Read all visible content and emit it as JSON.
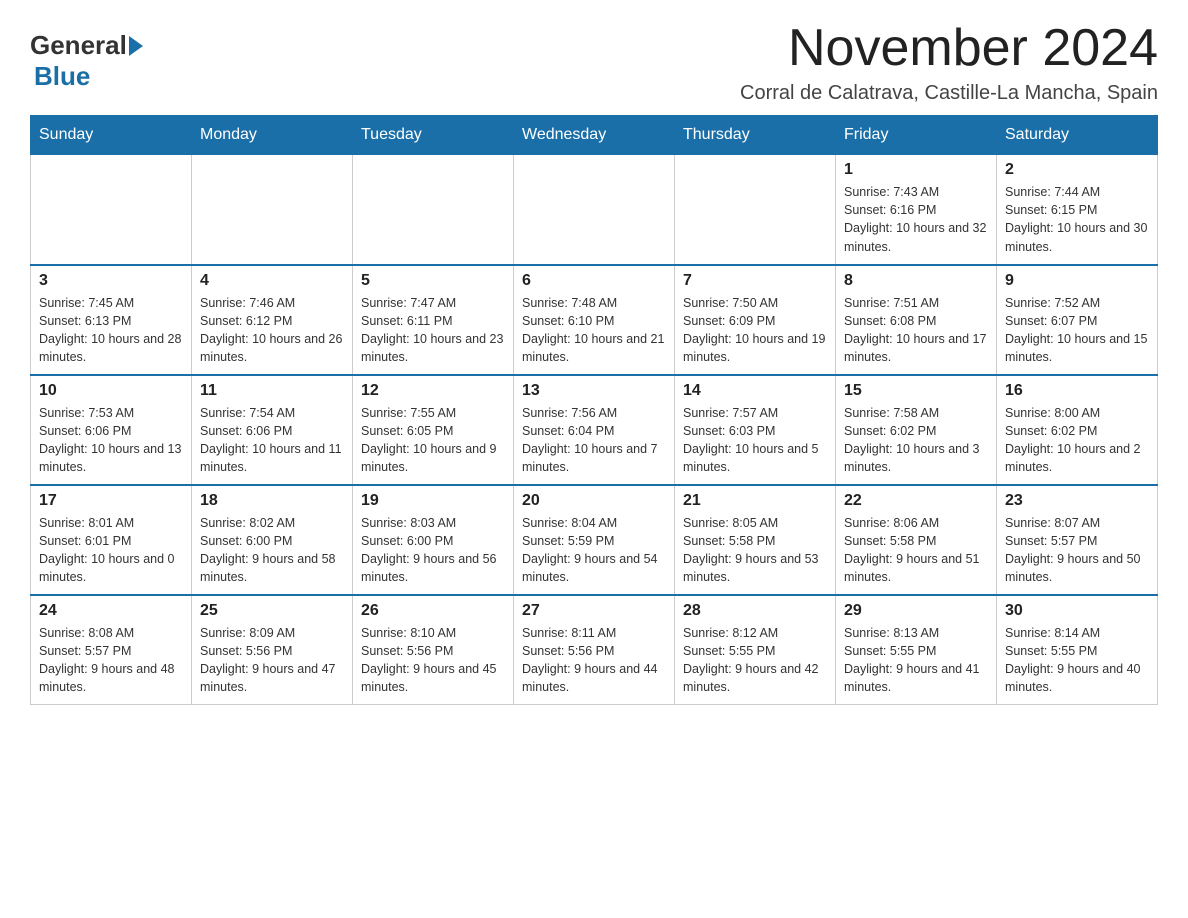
{
  "logo": {
    "general": "General",
    "blue": "Blue"
  },
  "title": "November 2024",
  "location": "Corral de Calatrava, Castille-La Mancha, Spain",
  "days_of_week": [
    "Sunday",
    "Monday",
    "Tuesday",
    "Wednesday",
    "Thursday",
    "Friday",
    "Saturday"
  ],
  "weeks": [
    [
      {
        "day": "",
        "info": ""
      },
      {
        "day": "",
        "info": ""
      },
      {
        "day": "",
        "info": ""
      },
      {
        "day": "",
        "info": ""
      },
      {
        "day": "",
        "info": ""
      },
      {
        "day": "1",
        "info": "Sunrise: 7:43 AM\nSunset: 6:16 PM\nDaylight: 10 hours and 32 minutes."
      },
      {
        "day": "2",
        "info": "Sunrise: 7:44 AM\nSunset: 6:15 PM\nDaylight: 10 hours and 30 minutes."
      }
    ],
    [
      {
        "day": "3",
        "info": "Sunrise: 7:45 AM\nSunset: 6:13 PM\nDaylight: 10 hours and 28 minutes."
      },
      {
        "day": "4",
        "info": "Sunrise: 7:46 AM\nSunset: 6:12 PM\nDaylight: 10 hours and 26 minutes."
      },
      {
        "day": "5",
        "info": "Sunrise: 7:47 AM\nSunset: 6:11 PM\nDaylight: 10 hours and 23 minutes."
      },
      {
        "day": "6",
        "info": "Sunrise: 7:48 AM\nSunset: 6:10 PM\nDaylight: 10 hours and 21 minutes."
      },
      {
        "day": "7",
        "info": "Sunrise: 7:50 AM\nSunset: 6:09 PM\nDaylight: 10 hours and 19 minutes."
      },
      {
        "day": "8",
        "info": "Sunrise: 7:51 AM\nSunset: 6:08 PM\nDaylight: 10 hours and 17 minutes."
      },
      {
        "day": "9",
        "info": "Sunrise: 7:52 AM\nSunset: 6:07 PM\nDaylight: 10 hours and 15 minutes."
      }
    ],
    [
      {
        "day": "10",
        "info": "Sunrise: 7:53 AM\nSunset: 6:06 PM\nDaylight: 10 hours and 13 minutes."
      },
      {
        "day": "11",
        "info": "Sunrise: 7:54 AM\nSunset: 6:06 PM\nDaylight: 10 hours and 11 minutes."
      },
      {
        "day": "12",
        "info": "Sunrise: 7:55 AM\nSunset: 6:05 PM\nDaylight: 10 hours and 9 minutes."
      },
      {
        "day": "13",
        "info": "Sunrise: 7:56 AM\nSunset: 6:04 PM\nDaylight: 10 hours and 7 minutes."
      },
      {
        "day": "14",
        "info": "Sunrise: 7:57 AM\nSunset: 6:03 PM\nDaylight: 10 hours and 5 minutes."
      },
      {
        "day": "15",
        "info": "Sunrise: 7:58 AM\nSunset: 6:02 PM\nDaylight: 10 hours and 3 minutes."
      },
      {
        "day": "16",
        "info": "Sunrise: 8:00 AM\nSunset: 6:02 PM\nDaylight: 10 hours and 2 minutes."
      }
    ],
    [
      {
        "day": "17",
        "info": "Sunrise: 8:01 AM\nSunset: 6:01 PM\nDaylight: 10 hours and 0 minutes."
      },
      {
        "day": "18",
        "info": "Sunrise: 8:02 AM\nSunset: 6:00 PM\nDaylight: 9 hours and 58 minutes."
      },
      {
        "day": "19",
        "info": "Sunrise: 8:03 AM\nSunset: 6:00 PM\nDaylight: 9 hours and 56 minutes."
      },
      {
        "day": "20",
        "info": "Sunrise: 8:04 AM\nSunset: 5:59 PM\nDaylight: 9 hours and 54 minutes."
      },
      {
        "day": "21",
        "info": "Sunrise: 8:05 AM\nSunset: 5:58 PM\nDaylight: 9 hours and 53 minutes."
      },
      {
        "day": "22",
        "info": "Sunrise: 8:06 AM\nSunset: 5:58 PM\nDaylight: 9 hours and 51 minutes."
      },
      {
        "day": "23",
        "info": "Sunrise: 8:07 AM\nSunset: 5:57 PM\nDaylight: 9 hours and 50 minutes."
      }
    ],
    [
      {
        "day": "24",
        "info": "Sunrise: 8:08 AM\nSunset: 5:57 PM\nDaylight: 9 hours and 48 minutes."
      },
      {
        "day": "25",
        "info": "Sunrise: 8:09 AM\nSunset: 5:56 PM\nDaylight: 9 hours and 47 minutes."
      },
      {
        "day": "26",
        "info": "Sunrise: 8:10 AM\nSunset: 5:56 PM\nDaylight: 9 hours and 45 minutes."
      },
      {
        "day": "27",
        "info": "Sunrise: 8:11 AM\nSunset: 5:56 PM\nDaylight: 9 hours and 44 minutes."
      },
      {
        "day": "28",
        "info": "Sunrise: 8:12 AM\nSunset: 5:55 PM\nDaylight: 9 hours and 42 minutes."
      },
      {
        "day": "29",
        "info": "Sunrise: 8:13 AM\nSunset: 5:55 PM\nDaylight: 9 hours and 41 minutes."
      },
      {
        "day": "30",
        "info": "Sunrise: 8:14 AM\nSunset: 5:55 PM\nDaylight: 9 hours and 40 minutes."
      }
    ]
  ]
}
